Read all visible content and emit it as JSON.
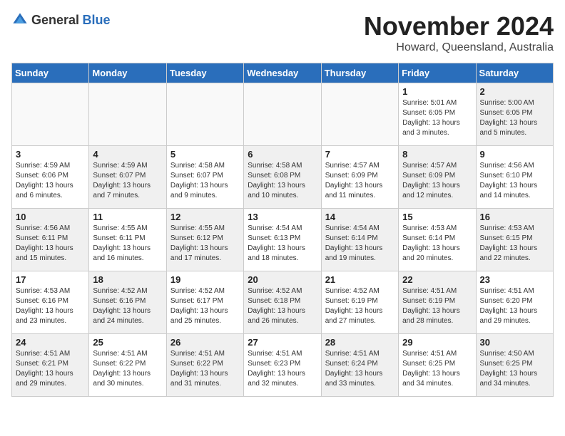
{
  "logo": {
    "general": "General",
    "blue": "Blue"
  },
  "title": "November 2024",
  "location": "Howard, Queensland, Australia",
  "days_of_week": [
    "Sunday",
    "Monday",
    "Tuesday",
    "Wednesday",
    "Thursday",
    "Friday",
    "Saturday"
  ],
  "weeks": [
    [
      {
        "day": "",
        "info": "",
        "empty": true
      },
      {
        "day": "",
        "info": "",
        "empty": true
      },
      {
        "day": "",
        "info": "",
        "empty": true
      },
      {
        "day": "",
        "info": "",
        "empty": true
      },
      {
        "day": "",
        "info": "",
        "empty": true
      },
      {
        "day": "1",
        "info": "Sunrise: 5:01 AM\nSunset: 6:05 PM\nDaylight: 13 hours\nand 3 minutes.",
        "empty": false,
        "shaded": false
      },
      {
        "day": "2",
        "info": "Sunrise: 5:00 AM\nSunset: 6:05 PM\nDaylight: 13 hours\nand 5 minutes.",
        "empty": false,
        "shaded": true
      }
    ],
    [
      {
        "day": "3",
        "info": "Sunrise: 4:59 AM\nSunset: 6:06 PM\nDaylight: 13 hours\nand 6 minutes.",
        "empty": false,
        "shaded": false
      },
      {
        "day": "4",
        "info": "Sunrise: 4:59 AM\nSunset: 6:07 PM\nDaylight: 13 hours\nand 7 minutes.",
        "empty": false,
        "shaded": true
      },
      {
        "day": "5",
        "info": "Sunrise: 4:58 AM\nSunset: 6:07 PM\nDaylight: 13 hours\nand 9 minutes.",
        "empty": false,
        "shaded": false
      },
      {
        "day": "6",
        "info": "Sunrise: 4:58 AM\nSunset: 6:08 PM\nDaylight: 13 hours\nand 10 minutes.",
        "empty": false,
        "shaded": true
      },
      {
        "day": "7",
        "info": "Sunrise: 4:57 AM\nSunset: 6:09 PM\nDaylight: 13 hours\nand 11 minutes.",
        "empty": false,
        "shaded": false
      },
      {
        "day": "8",
        "info": "Sunrise: 4:57 AM\nSunset: 6:09 PM\nDaylight: 13 hours\nand 12 minutes.",
        "empty": false,
        "shaded": true
      },
      {
        "day": "9",
        "info": "Sunrise: 4:56 AM\nSunset: 6:10 PM\nDaylight: 13 hours\nand 14 minutes.",
        "empty": false,
        "shaded": false
      }
    ],
    [
      {
        "day": "10",
        "info": "Sunrise: 4:56 AM\nSunset: 6:11 PM\nDaylight: 13 hours\nand 15 minutes.",
        "empty": false,
        "shaded": true
      },
      {
        "day": "11",
        "info": "Sunrise: 4:55 AM\nSunset: 6:11 PM\nDaylight: 13 hours\nand 16 minutes.",
        "empty": false,
        "shaded": false
      },
      {
        "day": "12",
        "info": "Sunrise: 4:55 AM\nSunset: 6:12 PM\nDaylight: 13 hours\nand 17 minutes.",
        "empty": false,
        "shaded": true
      },
      {
        "day": "13",
        "info": "Sunrise: 4:54 AM\nSunset: 6:13 PM\nDaylight: 13 hours\nand 18 minutes.",
        "empty": false,
        "shaded": false
      },
      {
        "day": "14",
        "info": "Sunrise: 4:54 AM\nSunset: 6:14 PM\nDaylight: 13 hours\nand 19 minutes.",
        "empty": false,
        "shaded": true
      },
      {
        "day": "15",
        "info": "Sunrise: 4:53 AM\nSunset: 6:14 PM\nDaylight: 13 hours\nand 20 minutes.",
        "empty": false,
        "shaded": false
      },
      {
        "day": "16",
        "info": "Sunrise: 4:53 AM\nSunset: 6:15 PM\nDaylight: 13 hours\nand 22 minutes.",
        "empty": false,
        "shaded": true
      }
    ],
    [
      {
        "day": "17",
        "info": "Sunrise: 4:53 AM\nSunset: 6:16 PM\nDaylight: 13 hours\nand 23 minutes.",
        "empty": false,
        "shaded": false
      },
      {
        "day": "18",
        "info": "Sunrise: 4:52 AM\nSunset: 6:16 PM\nDaylight: 13 hours\nand 24 minutes.",
        "empty": false,
        "shaded": true
      },
      {
        "day": "19",
        "info": "Sunrise: 4:52 AM\nSunset: 6:17 PM\nDaylight: 13 hours\nand 25 minutes.",
        "empty": false,
        "shaded": false
      },
      {
        "day": "20",
        "info": "Sunrise: 4:52 AM\nSunset: 6:18 PM\nDaylight: 13 hours\nand 26 minutes.",
        "empty": false,
        "shaded": true
      },
      {
        "day": "21",
        "info": "Sunrise: 4:52 AM\nSunset: 6:19 PM\nDaylight: 13 hours\nand 27 minutes.",
        "empty": false,
        "shaded": false
      },
      {
        "day": "22",
        "info": "Sunrise: 4:51 AM\nSunset: 6:19 PM\nDaylight: 13 hours\nand 28 minutes.",
        "empty": false,
        "shaded": true
      },
      {
        "day": "23",
        "info": "Sunrise: 4:51 AM\nSunset: 6:20 PM\nDaylight: 13 hours\nand 29 minutes.",
        "empty": false,
        "shaded": false
      }
    ],
    [
      {
        "day": "24",
        "info": "Sunrise: 4:51 AM\nSunset: 6:21 PM\nDaylight: 13 hours\nand 29 minutes.",
        "empty": false,
        "shaded": true
      },
      {
        "day": "25",
        "info": "Sunrise: 4:51 AM\nSunset: 6:22 PM\nDaylight: 13 hours\nand 30 minutes.",
        "empty": false,
        "shaded": false
      },
      {
        "day": "26",
        "info": "Sunrise: 4:51 AM\nSunset: 6:22 PM\nDaylight: 13 hours\nand 31 minutes.",
        "empty": false,
        "shaded": true
      },
      {
        "day": "27",
        "info": "Sunrise: 4:51 AM\nSunset: 6:23 PM\nDaylight: 13 hours\nand 32 minutes.",
        "empty": false,
        "shaded": false
      },
      {
        "day": "28",
        "info": "Sunrise: 4:51 AM\nSunset: 6:24 PM\nDaylight: 13 hours\nand 33 minutes.",
        "empty": false,
        "shaded": true
      },
      {
        "day": "29",
        "info": "Sunrise: 4:51 AM\nSunset: 6:25 PM\nDaylight: 13 hours\nand 34 minutes.",
        "empty": false,
        "shaded": false
      },
      {
        "day": "30",
        "info": "Sunrise: 4:50 AM\nSunset: 6:25 PM\nDaylight: 13 hours\nand 34 minutes.",
        "empty": false,
        "shaded": true
      }
    ]
  ]
}
